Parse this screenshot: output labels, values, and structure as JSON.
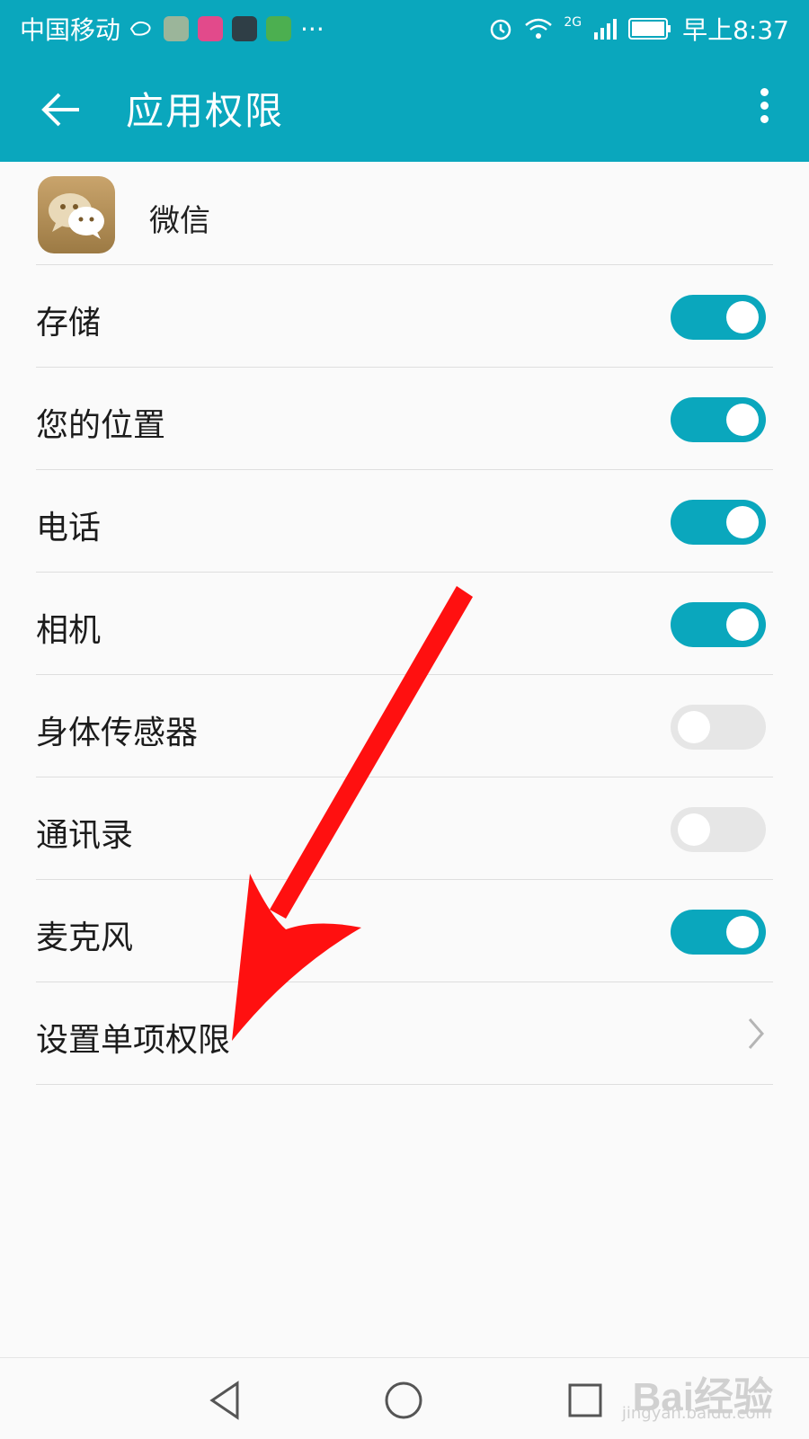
{
  "status": {
    "carrier": "中国移动",
    "overflow": "···",
    "signal_label": "2G",
    "time": "早上8:37",
    "notification_icons": [
      "wechat-notify-icon",
      "music-icon",
      "browser-icon",
      "qutoutiao-icon"
    ]
  },
  "header": {
    "title": "应用权限",
    "back_icon": "back-arrow-icon",
    "menu_icon": "more-vertical-icon"
  },
  "app": {
    "name": "微信",
    "icon": "wechat-app-icon"
  },
  "permissions": [
    {
      "label": "存储",
      "enabled": true
    },
    {
      "label": "您的位置",
      "enabled": true
    },
    {
      "label": "电话",
      "enabled": true
    },
    {
      "label": "相机",
      "enabled": true
    },
    {
      "label": "身体传感器",
      "enabled": false
    },
    {
      "label": "通讯录",
      "enabled": false
    },
    {
      "label": "麦克风",
      "enabled": true
    }
  ],
  "individual_permission": {
    "label": "设置单项权限",
    "icon": "chevron-right-icon"
  },
  "colors": {
    "accent": "#0aa7bd",
    "toggle_off": "#e6e6e6",
    "annotation_arrow": "#ff0000"
  },
  "watermark": {
    "text": "Bai经验",
    "url": "jingyan.baidu.com"
  }
}
